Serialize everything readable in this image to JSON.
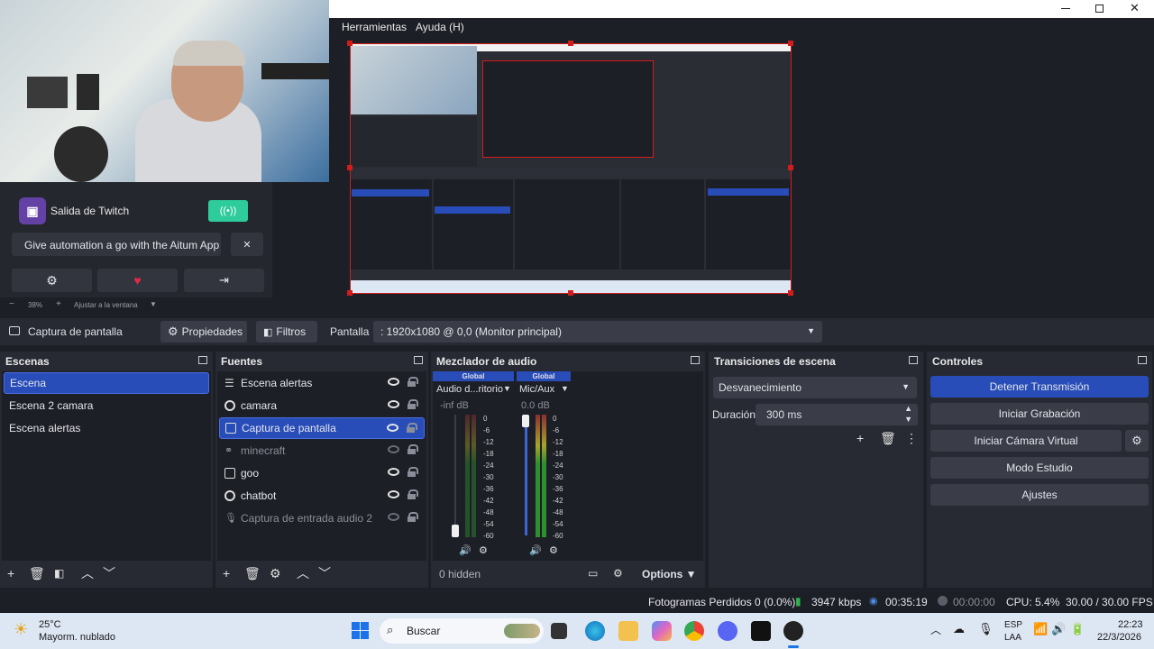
{
  "window": {
    "menu": [
      "Herramientas",
      "Ayuda (H)"
    ]
  },
  "twitch": {
    "title": "Salida de Twitch",
    "banner": "Give automation a go with the Aitum App",
    "close_glyph": "✕"
  },
  "zoom": {
    "value": "38%",
    "fit": "Ajustar a la ventana"
  },
  "source_toolbar": {
    "source_name": "Captura de pantalla",
    "properties": "Propiedades",
    "filters": "Filtros",
    "display_label": "Pantalla",
    "display_value": ": 1920x1080 @ 0,0 (Monitor principal)"
  },
  "scenes": {
    "title": "Escenas",
    "items": [
      "Escena",
      "Escena 2 camara",
      "Escena alertas"
    ]
  },
  "sources": {
    "title": "Fuentes",
    "items": [
      {
        "label": "Escena alertas"
      },
      {
        "label": "camara"
      },
      {
        "label": "Captura de pantalla"
      },
      {
        "label": "minecraft"
      },
      {
        "label": "goo"
      },
      {
        "label": "chatbot"
      },
      {
        "label": "Captura de entrada audio 2"
      }
    ]
  },
  "mixer": {
    "title": "Mezclador de audio",
    "channels": [
      {
        "badge": "Global",
        "name": "Audio d...ritorio",
        "level": "-inf dB",
        "fader": 0
      },
      {
        "badge": "Global",
        "name": "Mic/Aux",
        "level": "0.0 dB",
        "fader": 1
      }
    ],
    "scale": [
      "0",
      "-6",
      "-12",
      "-18",
      "-24",
      "-30",
      "-36",
      "-42",
      "-48",
      "-54",
      "-60"
    ],
    "hidden": "0 hidden",
    "options": "Options"
  },
  "transitions": {
    "title": "Transiciones de escena",
    "selected": "Desvanecimiento",
    "duration_label": "Duración",
    "duration_value": "300 ms"
  },
  "controls": {
    "title": "Controles",
    "buttons": [
      "Detener Transmisión",
      "Iniciar Grabación",
      "Iniciar Cámara Virtual",
      "Modo Estudio",
      "Ajustes"
    ]
  },
  "status": {
    "dropped": "Fotogramas Perdidos 0 (0.0%)",
    "bitrate": "3947 kbps",
    "stream_time": "00:35:19",
    "rec_time": "00:00:00",
    "cpu": "CPU: 5.4%",
    "fps": "30.00 / 30.00 FPS"
  },
  "taskbar": {
    "weather_temp": "25°C",
    "weather_desc": "Mayorm. nublado",
    "search": "Buscar",
    "lang1": "ESP",
    "lang2": "LAA",
    "time": "22:23",
    "date": "22/3/2026"
  },
  "colors": {
    "accent": "#284cb8",
    "twitch": "#6441a5",
    "live_green": "#2ecc9a",
    "preview_border": "#d21c1c"
  }
}
